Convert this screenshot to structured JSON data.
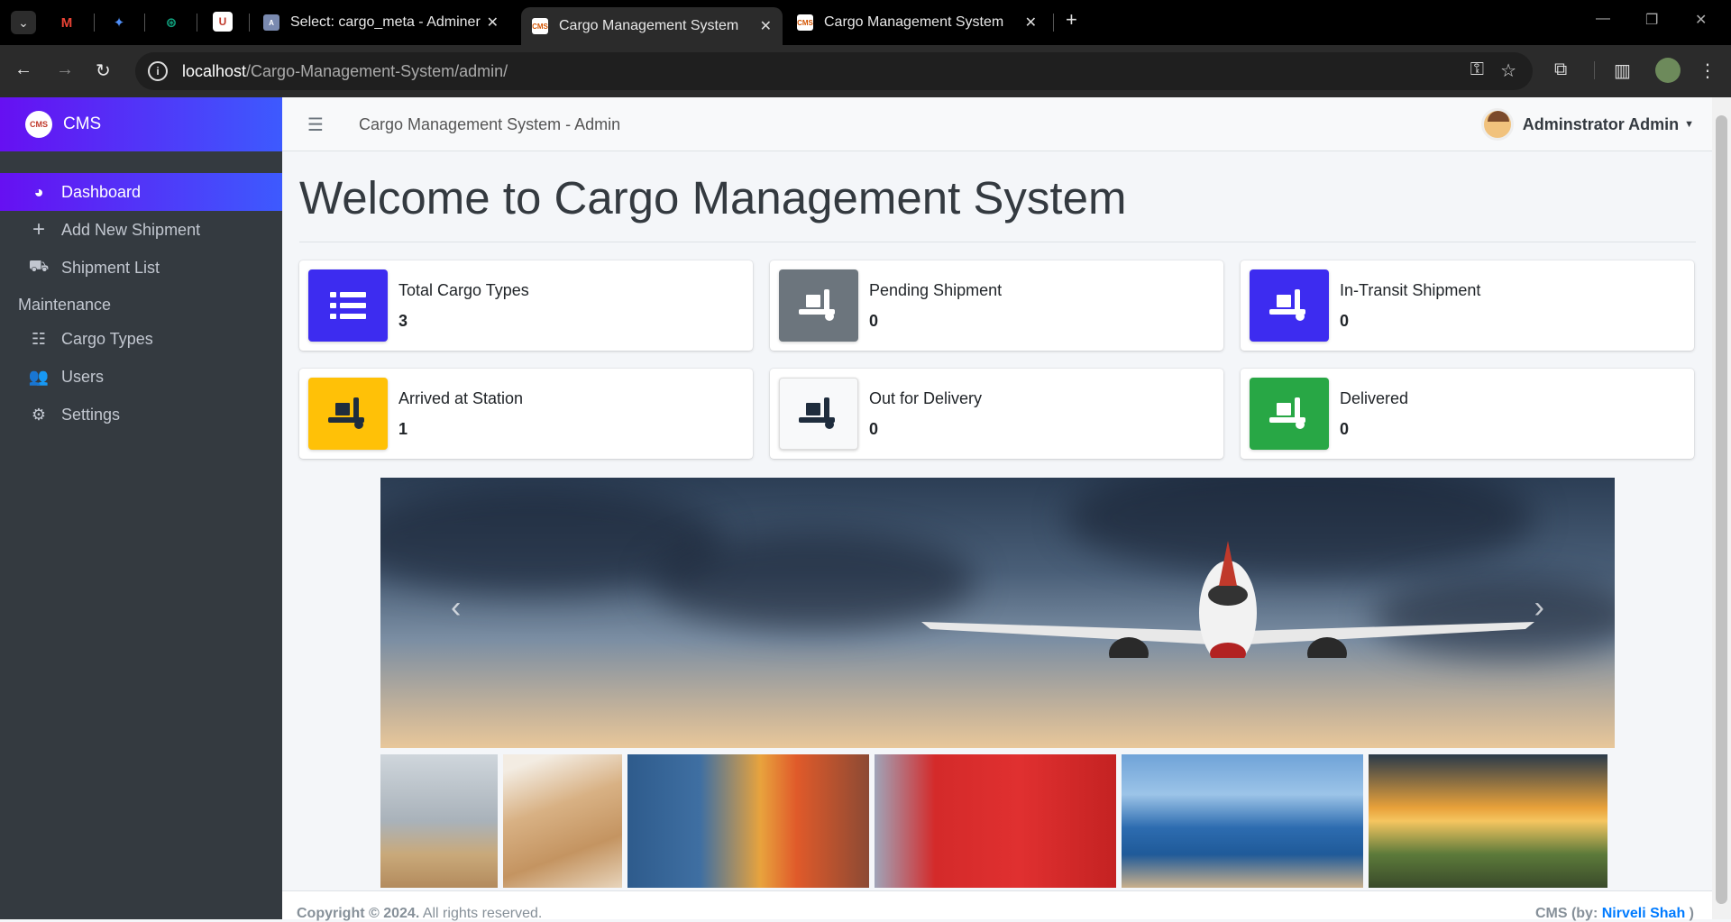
{
  "browser": {
    "tabs": [
      {
        "title": "Select: cargo_meta - Adminer",
        "active": false
      },
      {
        "title": "Cargo Management System",
        "active": true
      },
      {
        "title": "Cargo Management System",
        "active": false
      }
    ],
    "url_host": "localhost",
    "url_path": "/Cargo-Management-System/admin/"
  },
  "sidebar": {
    "brand": "CMS",
    "items": [
      {
        "label": "Dashboard",
        "icon": "tachometer-icon",
        "active": true
      },
      {
        "label": "Add New Shipment",
        "icon": "plus-icon"
      },
      {
        "label": "Shipment List",
        "icon": "dolly-icon"
      }
    ],
    "section_header": "Maintenance",
    "maintenance_items": [
      {
        "label": "Cargo Types",
        "icon": "th-list-icon"
      },
      {
        "label": "Users",
        "icon": "users-cog-icon"
      },
      {
        "label": "Settings",
        "icon": "cogs-icon"
      }
    ]
  },
  "header": {
    "title": "Cargo Management System - Admin",
    "user": "Adminstrator Admin"
  },
  "main": {
    "welcome": "Welcome to Cargo Management System",
    "cards": [
      {
        "label": "Total Cargo Types",
        "value": "3",
        "color": "#6610f2"
      },
      {
        "label": "Pending Shipment",
        "value": "0",
        "color": "#6c757d"
      },
      {
        "label": "In-Transit Shipment",
        "value": "0",
        "color": "#6610f2"
      },
      {
        "label": "Arrived at Station",
        "value": "1",
        "color": "#ffc107"
      },
      {
        "label": "Out for Delivery",
        "value": "0",
        "color": "#f8f9fa"
      },
      {
        "label": "Delivered",
        "value": "0",
        "color": "#28a745"
      }
    ]
  },
  "footer": {
    "copyright": "Copyright © 2024.",
    "rights": "All rights reserved.",
    "credit_prefix": "CMS (by:",
    "credit_name": "Nirveli Shah",
    "credit_suffix": ")"
  }
}
